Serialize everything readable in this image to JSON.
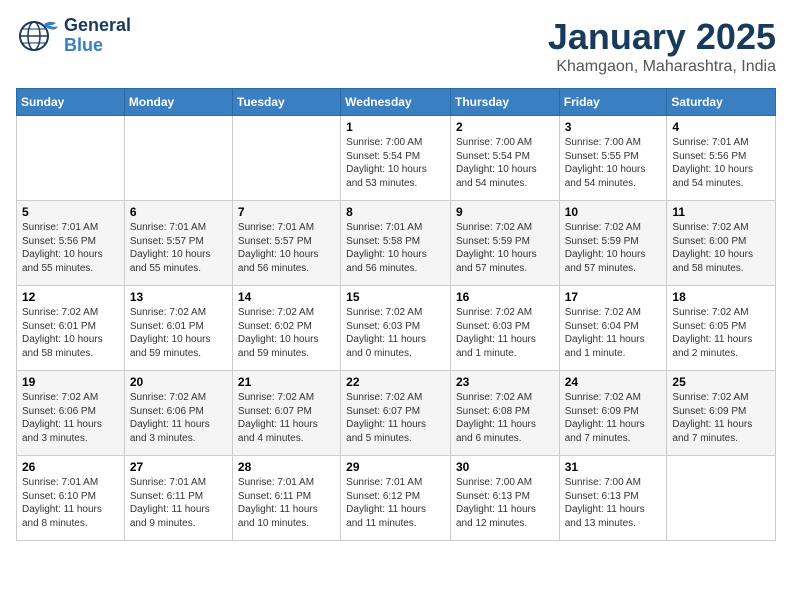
{
  "header": {
    "logo_line1": "General",
    "logo_line2": "Blue",
    "title": "January 2025",
    "subtitle": "Khamgaon, Maharashtra, India"
  },
  "weekdays": [
    "Sunday",
    "Monday",
    "Tuesday",
    "Wednesday",
    "Thursday",
    "Friday",
    "Saturday"
  ],
  "weeks": [
    [
      {
        "day": "",
        "sunrise": "",
        "sunset": "",
        "daylight": ""
      },
      {
        "day": "",
        "sunrise": "",
        "sunset": "",
        "daylight": ""
      },
      {
        "day": "",
        "sunrise": "",
        "sunset": "",
        "daylight": ""
      },
      {
        "day": "1",
        "sunrise": "Sunrise: 7:00 AM",
        "sunset": "Sunset: 5:54 PM",
        "daylight": "Daylight: 10 hours and 53 minutes."
      },
      {
        "day": "2",
        "sunrise": "Sunrise: 7:00 AM",
        "sunset": "Sunset: 5:54 PM",
        "daylight": "Daylight: 10 hours and 54 minutes."
      },
      {
        "day": "3",
        "sunrise": "Sunrise: 7:00 AM",
        "sunset": "Sunset: 5:55 PM",
        "daylight": "Daylight: 10 hours and 54 minutes."
      },
      {
        "day": "4",
        "sunrise": "Sunrise: 7:01 AM",
        "sunset": "Sunset: 5:56 PM",
        "daylight": "Daylight: 10 hours and 54 minutes."
      }
    ],
    [
      {
        "day": "5",
        "sunrise": "Sunrise: 7:01 AM",
        "sunset": "Sunset: 5:56 PM",
        "daylight": "Daylight: 10 hours and 55 minutes."
      },
      {
        "day": "6",
        "sunrise": "Sunrise: 7:01 AM",
        "sunset": "Sunset: 5:57 PM",
        "daylight": "Daylight: 10 hours and 55 minutes."
      },
      {
        "day": "7",
        "sunrise": "Sunrise: 7:01 AM",
        "sunset": "Sunset: 5:57 PM",
        "daylight": "Daylight: 10 hours and 56 minutes."
      },
      {
        "day": "8",
        "sunrise": "Sunrise: 7:01 AM",
        "sunset": "Sunset: 5:58 PM",
        "daylight": "Daylight: 10 hours and 56 minutes."
      },
      {
        "day": "9",
        "sunrise": "Sunrise: 7:02 AM",
        "sunset": "Sunset: 5:59 PM",
        "daylight": "Daylight: 10 hours and 57 minutes."
      },
      {
        "day": "10",
        "sunrise": "Sunrise: 7:02 AM",
        "sunset": "Sunset: 5:59 PM",
        "daylight": "Daylight: 10 hours and 57 minutes."
      },
      {
        "day": "11",
        "sunrise": "Sunrise: 7:02 AM",
        "sunset": "Sunset: 6:00 PM",
        "daylight": "Daylight: 10 hours and 58 minutes."
      }
    ],
    [
      {
        "day": "12",
        "sunrise": "Sunrise: 7:02 AM",
        "sunset": "Sunset: 6:01 PM",
        "daylight": "Daylight: 10 hours and 58 minutes."
      },
      {
        "day": "13",
        "sunrise": "Sunrise: 7:02 AM",
        "sunset": "Sunset: 6:01 PM",
        "daylight": "Daylight: 10 hours and 59 minutes."
      },
      {
        "day": "14",
        "sunrise": "Sunrise: 7:02 AM",
        "sunset": "Sunset: 6:02 PM",
        "daylight": "Daylight: 10 hours and 59 minutes."
      },
      {
        "day": "15",
        "sunrise": "Sunrise: 7:02 AM",
        "sunset": "Sunset: 6:03 PM",
        "daylight": "Daylight: 11 hours and 0 minutes."
      },
      {
        "day": "16",
        "sunrise": "Sunrise: 7:02 AM",
        "sunset": "Sunset: 6:03 PM",
        "daylight": "Daylight: 11 hours and 1 minute."
      },
      {
        "day": "17",
        "sunrise": "Sunrise: 7:02 AM",
        "sunset": "Sunset: 6:04 PM",
        "daylight": "Daylight: 11 hours and 1 minute."
      },
      {
        "day": "18",
        "sunrise": "Sunrise: 7:02 AM",
        "sunset": "Sunset: 6:05 PM",
        "daylight": "Daylight: 11 hours and 2 minutes."
      }
    ],
    [
      {
        "day": "19",
        "sunrise": "Sunrise: 7:02 AM",
        "sunset": "Sunset: 6:06 PM",
        "daylight": "Daylight: 11 hours and 3 minutes."
      },
      {
        "day": "20",
        "sunrise": "Sunrise: 7:02 AM",
        "sunset": "Sunset: 6:06 PM",
        "daylight": "Daylight: 11 hours and 3 minutes."
      },
      {
        "day": "21",
        "sunrise": "Sunrise: 7:02 AM",
        "sunset": "Sunset: 6:07 PM",
        "daylight": "Daylight: 11 hours and 4 minutes."
      },
      {
        "day": "22",
        "sunrise": "Sunrise: 7:02 AM",
        "sunset": "Sunset: 6:07 PM",
        "daylight": "Daylight: 11 hours and 5 minutes."
      },
      {
        "day": "23",
        "sunrise": "Sunrise: 7:02 AM",
        "sunset": "Sunset: 6:08 PM",
        "daylight": "Daylight: 11 hours and 6 minutes."
      },
      {
        "day": "24",
        "sunrise": "Sunrise: 7:02 AM",
        "sunset": "Sunset: 6:09 PM",
        "daylight": "Daylight: 11 hours and 7 minutes."
      },
      {
        "day": "25",
        "sunrise": "Sunrise: 7:02 AM",
        "sunset": "Sunset: 6:09 PM",
        "daylight": "Daylight: 11 hours and 7 minutes."
      }
    ],
    [
      {
        "day": "26",
        "sunrise": "Sunrise: 7:01 AM",
        "sunset": "Sunset: 6:10 PM",
        "daylight": "Daylight: 11 hours and 8 minutes."
      },
      {
        "day": "27",
        "sunrise": "Sunrise: 7:01 AM",
        "sunset": "Sunset: 6:11 PM",
        "daylight": "Daylight: 11 hours and 9 minutes."
      },
      {
        "day": "28",
        "sunrise": "Sunrise: 7:01 AM",
        "sunset": "Sunset: 6:11 PM",
        "daylight": "Daylight: 11 hours and 10 minutes."
      },
      {
        "day": "29",
        "sunrise": "Sunrise: 7:01 AM",
        "sunset": "Sunset: 6:12 PM",
        "daylight": "Daylight: 11 hours and 11 minutes."
      },
      {
        "day": "30",
        "sunrise": "Sunrise: 7:00 AM",
        "sunset": "Sunset: 6:13 PM",
        "daylight": "Daylight: 11 hours and 12 minutes."
      },
      {
        "day": "31",
        "sunrise": "Sunrise: 7:00 AM",
        "sunset": "Sunset: 6:13 PM",
        "daylight": "Daylight: 11 hours and 13 minutes."
      },
      {
        "day": "",
        "sunrise": "",
        "sunset": "",
        "daylight": ""
      }
    ]
  ]
}
